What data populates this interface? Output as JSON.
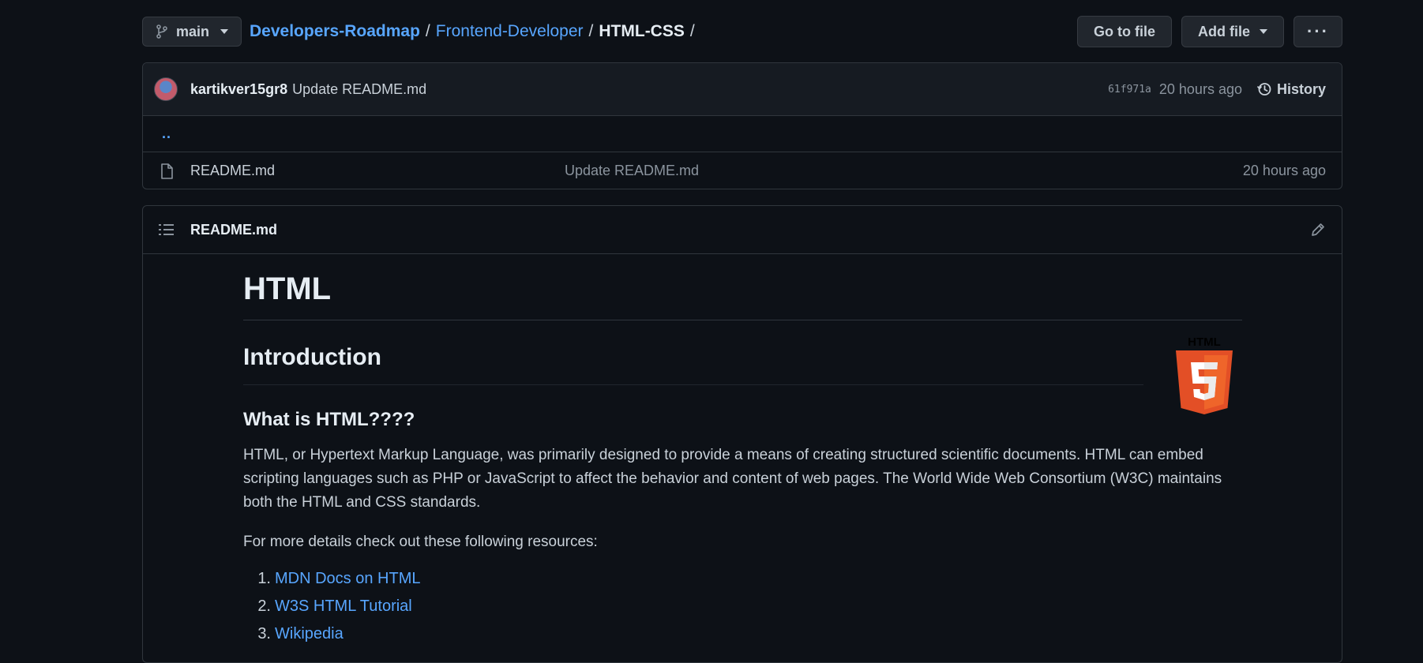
{
  "topbar": {
    "branch": "main",
    "breadcrumb": [
      {
        "label": "Developers-Roadmap"
      },
      {
        "label": "Frontend-Developer"
      }
    ],
    "current": "HTML-CSS",
    "separator": "/",
    "go_to_file": "Go to file",
    "add_file": "Add file",
    "more": "···"
  },
  "commit": {
    "author": "kartikver15gr8",
    "message": "Update README.md",
    "sha": "61f971a",
    "time": "20 hours ago",
    "history": "History"
  },
  "files": {
    "parent": "..",
    "rows": [
      {
        "name": "README.md",
        "message": "Update README.md",
        "time": "20 hours ago"
      }
    ]
  },
  "readme": {
    "filename": "README.md",
    "h1": "HTML",
    "h2": "Introduction",
    "h3": "What is HTML????",
    "para1": "HTML, or Hypertext Markup Language, was primarily designed to provide a means of creating structured scientific documents. HTML can embed scripting languages such as PHP or JavaScript to affect the behavior and content of web pages. The World Wide Web Consortium (W3C) maintains both the HTML and CSS standards.",
    "para2": "For more details check out these following resources:",
    "resources": [
      {
        "num": "1.",
        "label": "MDN Docs on HTML"
      },
      {
        "num": "2.",
        "label": "W3S HTML Tutorial"
      },
      {
        "num": "3.",
        "label": "Wikipedia"
      }
    ],
    "logo_text": "HTML"
  },
  "colors": {
    "background": "#0d1117",
    "link": "#58a6ff",
    "border": "#30363d",
    "html5_orange": "#e34f26"
  }
}
